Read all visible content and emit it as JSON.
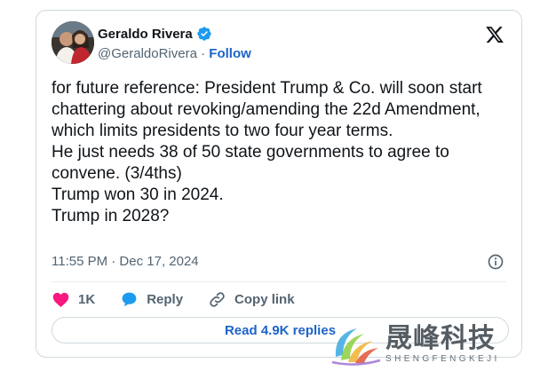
{
  "post": {
    "author_name": "Geraldo Rivera",
    "handle": "@GeraldoRivera",
    "separator": "·",
    "follow_label": "Follow",
    "text": "for future reference: President Trump & Co. will soon start chattering about revoking/amending the 22d Amendment, which limits presidents to two four year terms.\nHe just needs 38 of 50 state governments to agree to convene. (3/4ths)\nTrump won 30 in 2024.\nTrump in 2028?",
    "timestamp": "11:55 PM · Dec 17, 2024"
  },
  "actions": {
    "like_count": "1K",
    "reply_label": "Reply",
    "copy_link_label": "Copy link"
  },
  "replies_button": {
    "label": "Read 4.9K replies"
  },
  "watermark": {
    "chinese": "晟峰科技",
    "english": "SHENGFENGKEJI"
  },
  "colors": {
    "accent": "#1d64c8",
    "like": "#f91880",
    "reply_icon": "#1d9bf0",
    "text_secondary": "#536471"
  },
  "icons": [
    "verified-badge-icon",
    "x-logo-icon",
    "info-icon",
    "heart-icon",
    "reply-bubble-icon",
    "link-icon"
  ]
}
